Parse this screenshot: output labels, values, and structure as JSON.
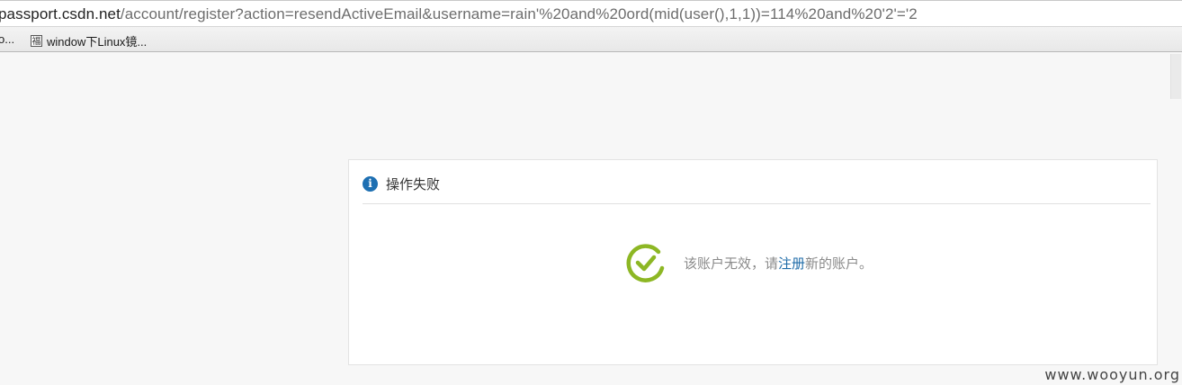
{
  "browser": {
    "url_host": "passport.csdn.net",
    "url_rest": "/account/register?action=resendActiveEmail&username=rain'%20and%20ord(mid(user(),1,1))=114%20and%20'2'='2",
    "bookmarks": [
      {
        "label": "o..."
      },
      {
        "icon_glyph": "福",
        "label": "window下Linux镜..."
      }
    ]
  },
  "panel": {
    "title": "操作失败",
    "message_before": "该账户无效，请",
    "message_link": "注册",
    "message_after": "新的账户。"
  },
  "watermark": "www.wooyun.org",
  "colors": {
    "info_icon": "#1d6fb2",
    "check_icon": "#8db724",
    "link": "#1e6ba8"
  },
  "icons": {
    "info": "info-icon",
    "success": "check-circle-icon"
  }
}
